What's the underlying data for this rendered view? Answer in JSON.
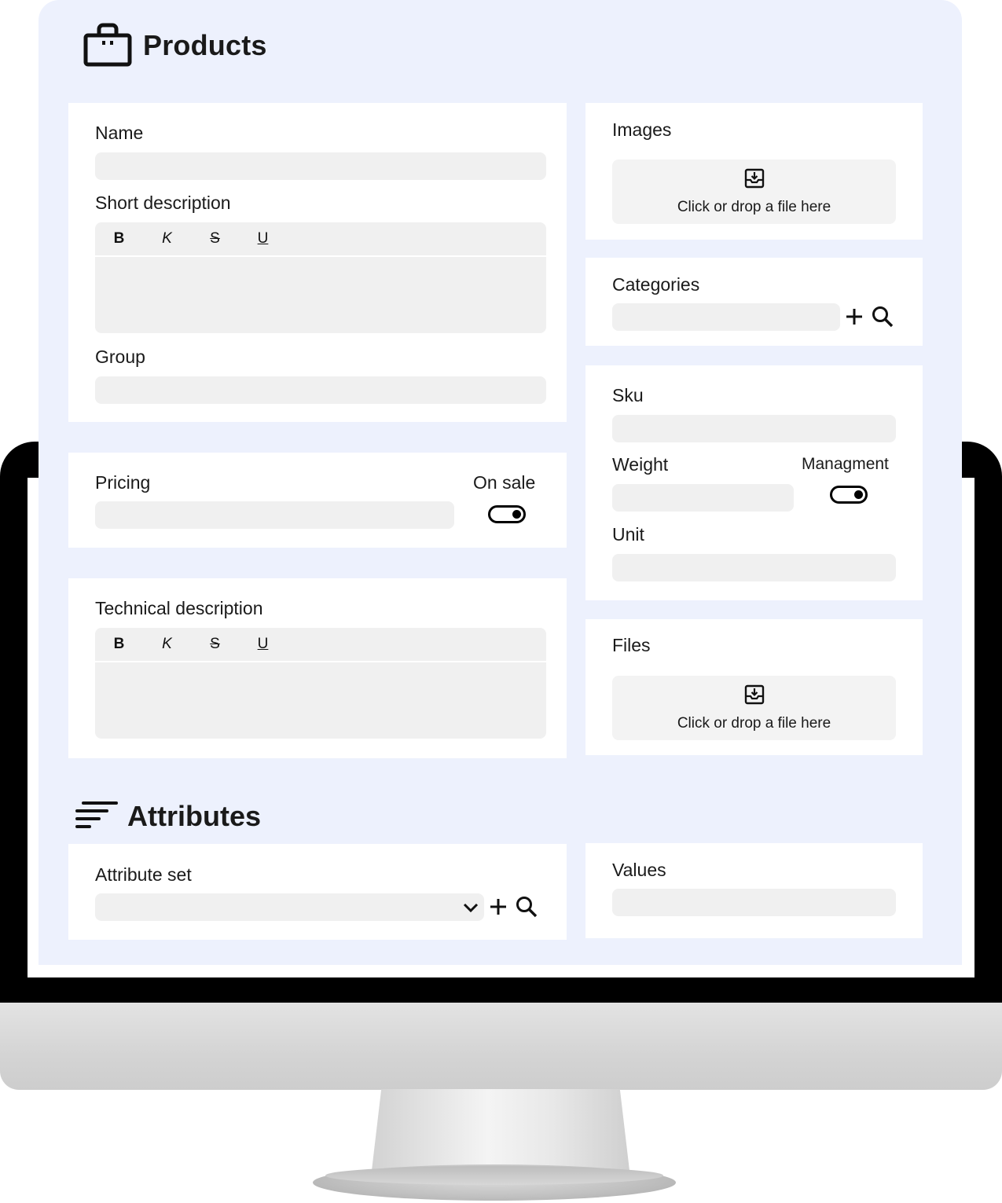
{
  "page": {
    "title": "Products",
    "title_icon": "shopping-bag-icon"
  },
  "main_card": {
    "name_label": "Name",
    "name_value": "",
    "short_description_label": "Short description",
    "short_description_value": "",
    "group_label": "Group",
    "group_value": ""
  },
  "editor_toolbar": {
    "bold": "B",
    "italic": "K",
    "strikethrough": "S",
    "underline": "U"
  },
  "pricing": {
    "label": "Pricing",
    "value": "",
    "on_sale_label": "On sale",
    "on_sale_toggle": "on"
  },
  "technical": {
    "label": "Technical description",
    "value": ""
  },
  "images": {
    "label": "Images",
    "dropzone_text": "Click or drop a file here",
    "icon": "inbox-download-icon"
  },
  "categories": {
    "label": "Categories",
    "value": "",
    "add_icon": "plus-icon",
    "search_icon": "search-icon"
  },
  "sku_card": {
    "sku_label": "Sku",
    "sku_value": "",
    "weight_label": "Weight",
    "weight_value": "",
    "management_label": "Managment",
    "management_toggle": "on",
    "unit_label": "Unit",
    "unit_value": ""
  },
  "files": {
    "label": "Files",
    "dropzone_text": "Click or drop a file here",
    "icon": "inbox-download-icon"
  },
  "attributes": {
    "title": "Attributes",
    "title_icon": "sort-lines-icon",
    "attribute_set_label": "Attribute set",
    "attribute_set_value": "",
    "values_label": "Values",
    "values_value": ""
  },
  "colors": {
    "panel_background": "#edf1fd",
    "field_background": "#f0f0f0",
    "bezel": "#000000"
  }
}
